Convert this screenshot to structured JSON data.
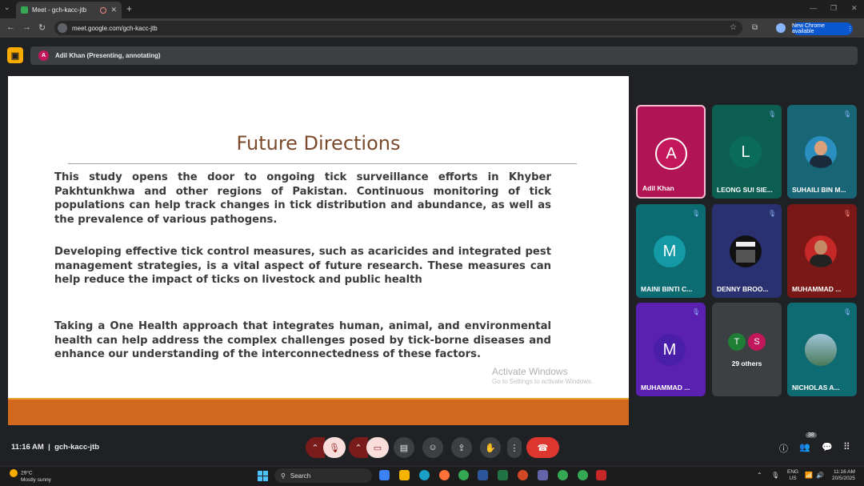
{
  "browser": {
    "tab_title": "Meet - gch-kacc-jtb",
    "tab_close": "✕",
    "new_tab": "+",
    "url": "meet.google.com/gch-kacc-jtb",
    "update_label": "New Chrome available",
    "update_menu": "⋮"
  },
  "presenting": {
    "avatar_letter": "A",
    "label": "Adil Khan (Presenting, annotating)"
  },
  "slide": {
    "title": "Future Directions",
    "paragraphs": [
      "This study opens the door to ongoing tick surveillance efforts in Khyber Pakhtunkhwa and other regions of Pakistan. Continuous monitoring of tick populations can help track changes in tick distribution and abundance, as well as the prevalence of various pathogens.",
      "Developing effective tick control measures, such as acaricides and integrated pest management strategies, is a vital aspect of future research. These measures can help reduce the impact of ticks on livestock and public health",
      "Taking a One Health approach that integrates human, animal, and environmental health can help address the complex challenges posed by tick-borne diseases and enhance our understanding of the interconnectedness of these factors."
    ],
    "watermark_title": "Activate Windows",
    "watermark_sub": "Go to Settings to activate Windows."
  },
  "participants": [
    {
      "name": "Adil Khan",
      "letter": "A",
      "bg": "#c2185b",
      "tile_bg": "#b01455",
      "muted": false
    },
    {
      "name": "LEONG SUI SIE...",
      "letter": "L",
      "bg": "#0b6b5a",
      "tile_bg": "#0b5e50",
      "muted": true
    },
    {
      "name": "SUHAILI BIN M...",
      "letter": "",
      "bg": "#1f6a7a",
      "tile_bg": "#176575",
      "muted": true
    },
    {
      "name": "MAINI BINTI C...",
      "letter": "M",
      "bg": "#139aa5",
      "tile_bg": "#0d6c72",
      "muted": true
    },
    {
      "name": "DENNY BROO...",
      "letter": "",
      "bg": "#111",
      "tile_bg": "#2a3170",
      "muted": true
    },
    {
      "name": "MUHAMMAD ...",
      "letter": "",
      "bg": "#7a1b1b",
      "tile_bg": "#7a1717",
      "muted": true
    },
    {
      "name": "MUHAMMAD ...",
      "letter": "M",
      "bg": "#4a1fa8",
      "tile_bg": "#5a20b0",
      "muted": true
    },
    {
      "name": "29 others",
      "letter": "",
      "bg": "",
      "tile_bg": "#3c4043",
      "muted": false
    },
    {
      "name": "NICHOLAS A...",
      "letter": "",
      "bg": "#6f9fb3",
      "tile_bg": "#0f6b72",
      "muted": true
    }
  ],
  "others_letters": [
    "T",
    "S"
  ],
  "others_colors": [
    "#1e7e34",
    "#c2185b"
  ],
  "bottom": {
    "time": "11:16 AM",
    "separator": "|",
    "meeting_code": "gch-kacc-jtb",
    "people_count": "38"
  },
  "taskbar": {
    "temp": "29°C",
    "weather": "Mostly sunny",
    "search": "Search",
    "lang1": "ENG",
    "lang2": "US",
    "time": "11:16 AM",
    "date": "20/5/2025"
  }
}
